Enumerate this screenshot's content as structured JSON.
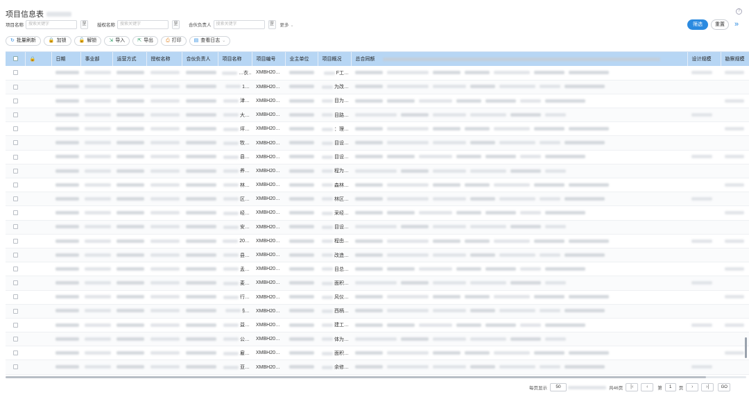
{
  "page": {
    "title": "项目信息表"
  },
  "filters": [
    {
      "label": "项目名称",
      "placeholder": "搜索关键字",
      "button": "罡"
    },
    {
      "label": "授权名称",
      "placeholder": "搜索关键字",
      "button": "罡"
    },
    {
      "label": "合伙负责人",
      "placeholder": "搜索关键字",
      "button": "罡"
    }
  ],
  "more_label": "更多",
  "actions": {
    "filter": "筛选",
    "reset": "重置"
  },
  "toolbar": [
    {
      "name": "batch-refresh-button",
      "icon": "refresh-icon",
      "glyph": "↻",
      "label": "批量刷新",
      "color": "#2b8ae0"
    },
    {
      "name": "lock-button",
      "icon": "lock-icon",
      "glyph": "🔒",
      "label": "加锁",
      "color": "#2b8ae0"
    },
    {
      "name": "unlock-button",
      "icon": "unlock-icon",
      "glyph": "🔓",
      "label": "解锁",
      "color": "#2b8ae0"
    },
    {
      "name": "import-button",
      "icon": "import-icon",
      "glyph": "⇲",
      "label": "导入",
      "color": "#3aa36e"
    },
    {
      "name": "export-button",
      "icon": "export-icon",
      "glyph": "⇱",
      "label": "导出",
      "color": "#3aa36e"
    },
    {
      "name": "print-button",
      "icon": "print-icon",
      "glyph": "⎙",
      "label": "打印",
      "color": "#e38a2c"
    },
    {
      "name": "view-log-button",
      "icon": "log-icon",
      "glyph": "▤",
      "label": "查看日志",
      "color": "#2b8ae0"
    }
  ],
  "table": {
    "columns": [
      "日期",
      "事业部",
      "运营方式",
      "授权名称",
      "合伙负责人",
      "项目名称",
      "项目编号",
      "业主单位",
      "项目概况",
      "总合同额",
      "设计规模",
      "勘察规模"
    ],
    "rows": [
      {
        "name_tail": "…衣…",
        "code": "XMBH20…",
        "summary": "F工…"
      },
      {
        "name_tail": "1…",
        "code": "XMBH20…",
        "summary": "为改…"
      },
      {
        "name_tail": "津…",
        "code": "XMBH20…",
        "summary": "目为…"
      },
      {
        "name_tail": "大…",
        "code": "XMBH20…",
        "summary": "目路…"
      },
      {
        "name_tail": "坪…",
        "code": "XMBH20…",
        "summary": "：理…"
      },
      {
        "name_tail": "牧…",
        "code": "XMBH20…",
        "summary": "目设…"
      },
      {
        "name_tail": "县…",
        "code": "XMBH20…",
        "summary": "目设…"
      },
      {
        "name_tail": "养…",
        "code": "XMBH20…",
        "summary": "程为…"
      },
      {
        "name_tail": "林…",
        "code": "XMBH20…",
        "summary": "森林…"
      },
      {
        "name_tail": "区…",
        "code": "XMBH20…",
        "summary": "林区…"
      },
      {
        "name_tail": "经…",
        "code": "XMBH20…",
        "summary": "采经…"
      },
      {
        "name_tail": "安…",
        "code": "XMBH20…",
        "summary": "目设…"
      },
      {
        "name_tail": "20…",
        "code": "XMBH20…",
        "summary": "程由…"
      },
      {
        "name_tail": "县…",
        "code": "XMBH20…",
        "summary": "改造…"
      },
      {
        "name_tail": "孟…",
        "code": "XMBH20…",
        "summary": "目总…"
      },
      {
        "name_tail": "麦…",
        "code": "XMBH20…",
        "summary": "面积…"
      },
      {
        "name_tail": "行…",
        "code": "XMBH20…",
        "summary": "风仪…"
      },
      {
        "name_tail": "§…",
        "code": "XMBH20…",
        "summary": "西柄…"
      },
      {
        "name_tail": "益…",
        "code": "XMBH20…",
        "summary": "建工…"
      },
      {
        "name_tail": "公…",
        "code": "XMBH20…",
        "summary": "体为…"
      },
      {
        "name_tail": "雇…",
        "code": "XMBH20…",
        "summary": "面积…"
      },
      {
        "name_tail": "亚…",
        "code": "XMBH20…",
        "summary": "余修…"
      }
    ]
  },
  "pagination": {
    "per_page_label": "每页显示",
    "per_page": "50",
    "total": "共46页",
    "page_label": "第",
    "page": "1",
    "page_suffix": "页",
    "go": "GO"
  }
}
